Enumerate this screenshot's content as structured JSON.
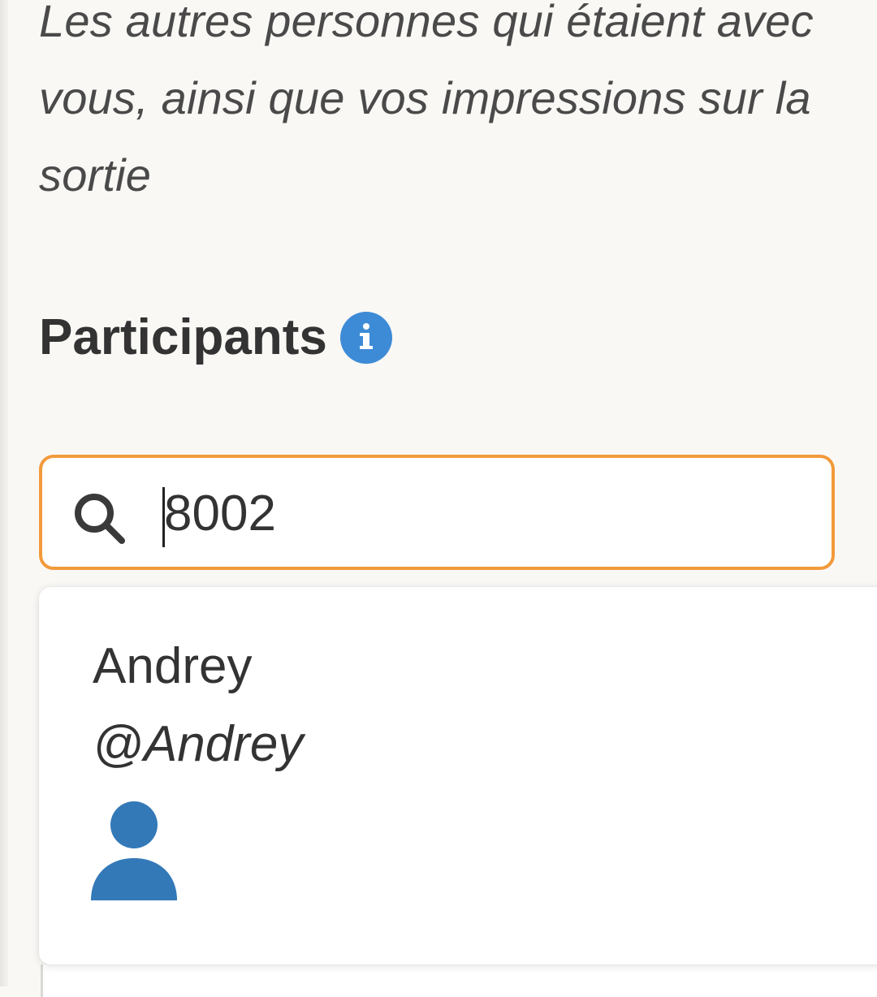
{
  "form": {
    "helper_text": "Les autres personnes qui étaient avec vous, ainsi que vos impressions sur la sortie",
    "participants_label": "Participants"
  },
  "search": {
    "value": "8002"
  },
  "results": [
    {
      "name": "Andrey",
      "handle": "@Andrey",
      "avatar_icon": "user-silhouette-icon"
    }
  ],
  "colors": {
    "info_blue": "#3d8bd6",
    "focus_orange": "#f29a3c",
    "avatar_blue": "#3379b8",
    "text_dark": "#333333"
  },
  "icons": {
    "info": "info-circle-icon",
    "search": "magnifier-search-icon"
  }
}
